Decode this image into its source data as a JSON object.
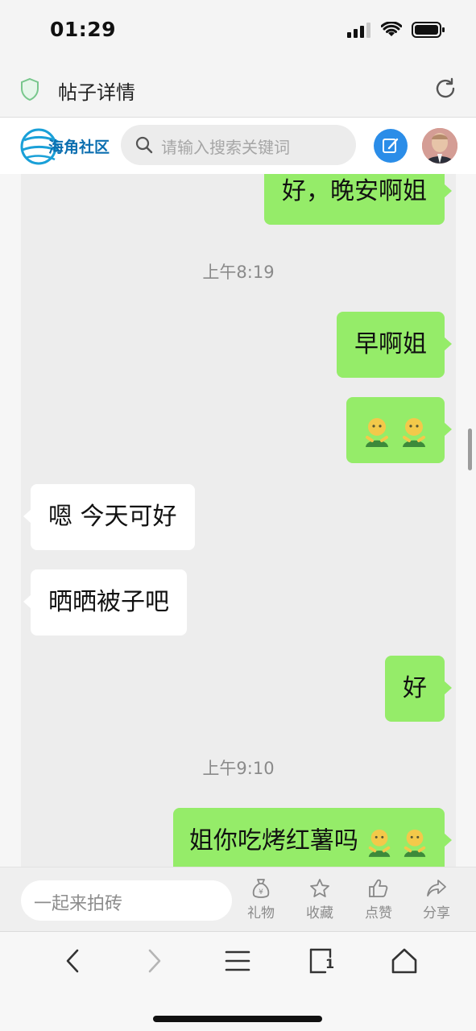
{
  "status_bar": {
    "time": "01:29"
  },
  "browser": {
    "title": "帖子详情"
  },
  "site": {
    "logo_text": "海角社区",
    "search_placeholder": "请输入搜索关键词"
  },
  "chat": {
    "messages": [
      {
        "side": "right",
        "text": "好，晚安啊姐"
      },
      {
        "side": "time",
        "text": "上午8:19"
      },
      {
        "side": "right",
        "text": "早啊姐"
      },
      {
        "side": "right",
        "text": "",
        "emoji_count": 2
      },
      {
        "side": "left",
        "text": "嗯 今天可好"
      },
      {
        "side": "left",
        "text": "晒晒被子吧"
      },
      {
        "side": "right",
        "text": "好"
      },
      {
        "side": "time",
        "text": "上午9:10"
      },
      {
        "side": "right",
        "text": "姐你吃烤红薯吗",
        "emoji_count": 2
      }
    ],
    "colors": {
      "outgoing": "#95ec69",
      "incoming": "#ffffff",
      "background": "#ededed"
    }
  },
  "action_bar": {
    "comment_placeholder": "一起来拍砖",
    "gift_label": "礼物",
    "favorite_label": "收藏",
    "like_label": "点赞",
    "share_label": "分享"
  },
  "toolbar": {
    "tabs_count": "1"
  },
  "icons": {
    "status": [
      "signal-icon",
      "wifi-icon",
      "battery-icon"
    ],
    "browser": [
      "shield-icon",
      "reload-icon"
    ],
    "header": [
      "search-icon",
      "edit-icon"
    ],
    "actions": [
      "money-bag-icon",
      "star-icon",
      "thumbs-up-icon",
      "share-arrow-icon"
    ],
    "toolbar": [
      "back-icon",
      "forward-icon",
      "menu-icon",
      "tabs-icon",
      "home-icon"
    ]
  }
}
